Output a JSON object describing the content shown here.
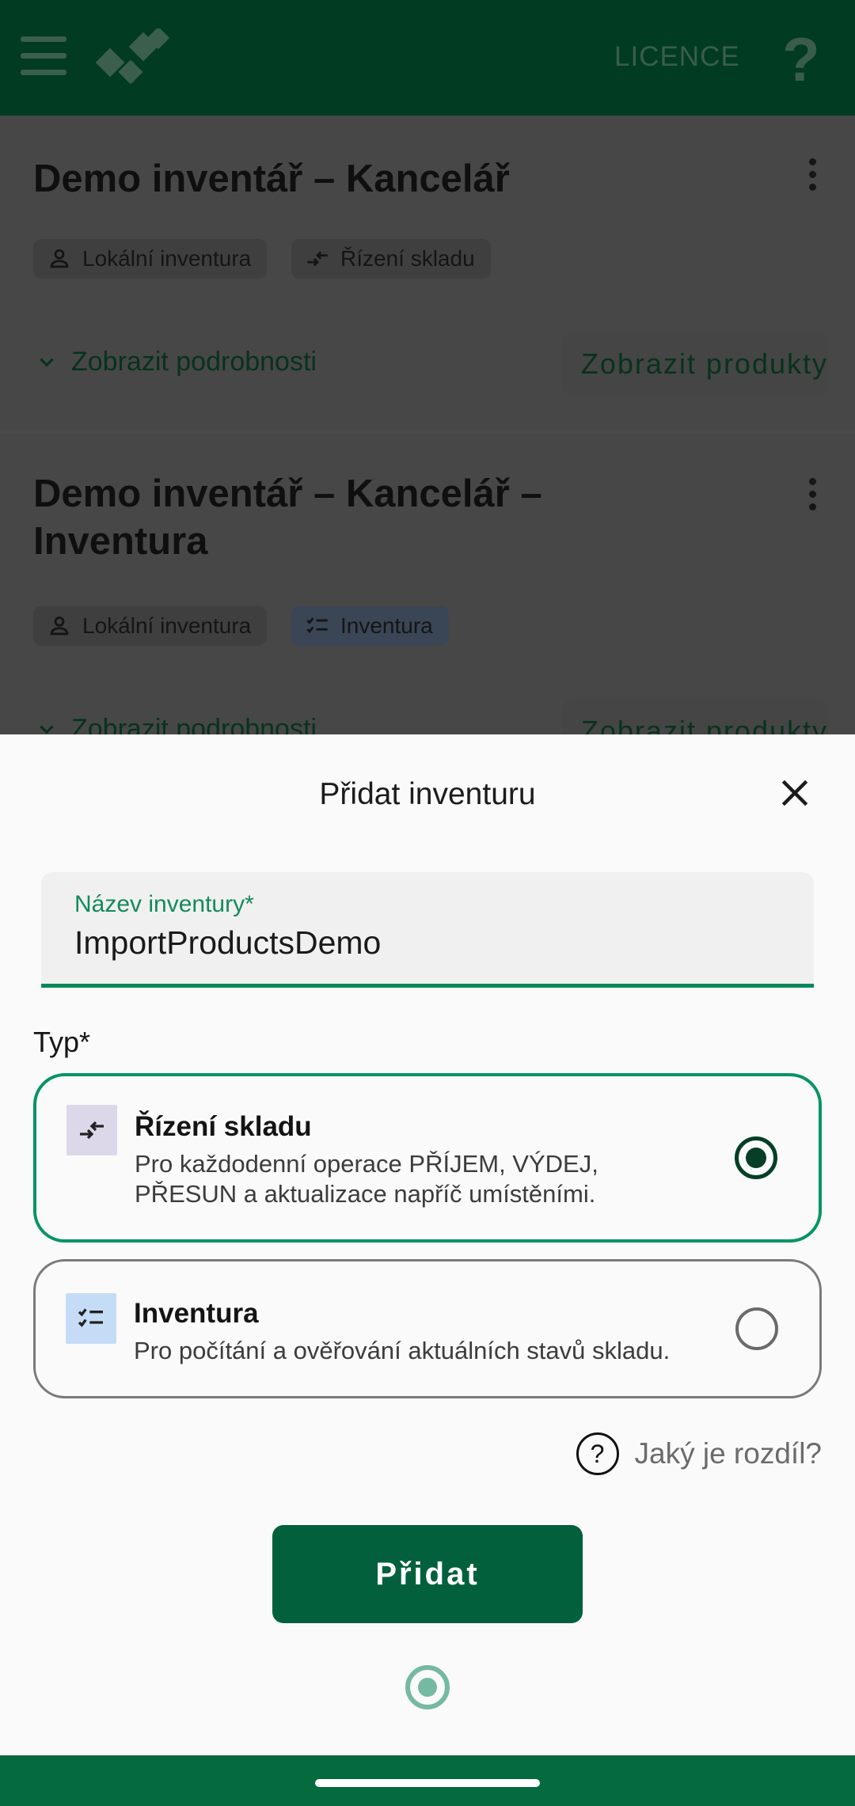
{
  "appbar": {
    "licence_label": "LICENCE",
    "help_label": "?"
  },
  "inventories": [
    {
      "title_lines": [
        "Demo inventář – Kancelář"
      ],
      "chips": [
        {
          "icon": "person-icon",
          "label": "Lokální inventura"
        },
        {
          "icon": "stock-control-icon",
          "label": "Řízení skladu"
        }
      ],
      "details_label": "Zobrazit podrobnosti",
      "products_label": "Zobrazit produkty"
    },
    {
      "title_lines": [
        "Demo inventář – Kancelář –",
        "Inventura"
      ],
      "chips": [
        {
          "icon": "person-icon",
          "label": "Lokální inventura"
        },
        {
          "icon": "checklist-icon",
          "label": "Inventura"
        }
      ],
      "details_label": "Zobrazit podrobnosti",
      "products_label": "Zobrazit produkty"
    }
  ],
  "sheet": {
    "title": "Přidat inventuru",
    "name_field": {
      "label": "Název inventury*",
      "value": "ImportProductsDemo"
    },
    "type_label": "Typ*",
    "options": [
      {
        "title": "Řízení skladu",
        "description": "Pro každodenní operace PŘÍJEM, VÝDEJ, PŘESUN a aktualizace napříč umístěními.",
        "selected": true,
        "icon": "stock-control-icon"
      },
      {
        "title": "Inventura",
        "description": "Pro počítání a ověřování aktuálních stavů skladu.",
        "selected": false,
        "icon": "checklist-icon"
      }
    ],
    "difference_label": "Jaký je rozdíl?",
    "add_button_label": "Přidat"
  },
  "colors": {
    "primary_dark": "#03603c",
    "accent_green": "#079466",
    "appbar": "#013b22"
  }
}
